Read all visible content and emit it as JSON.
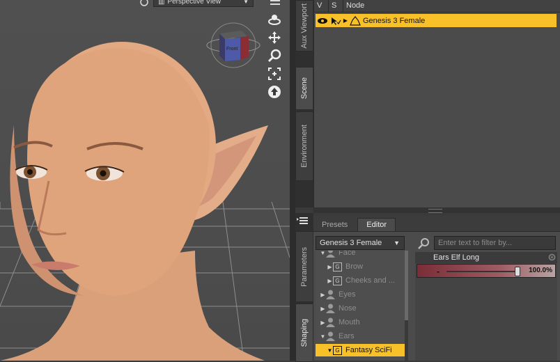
{
  "viewport": {
    "view_dropdown": "Perspective View"
  },
  "side_tabs_top": [
    {
      "label": "Aux Viewport"
    },
    {
      "label": "Scene"
    },
    {
      "label": "Environment"
    }
  ],
  "side_tabs_bottom": [
    {
      "label": "Parameters"
    },
    {
      "label": "Shaping"
    }
  ],
  "scene": {
    "columns": {
      "visible": "V",
      "select": "S",
      "node": "Node"
    },
    "nodes": [
      {
        "label": "Genesis 3 Female",
        "selected": true
      }
    ]
  },
  "params": {
    "tabs": [
      {
        "label": "Presets",
        "active": false
      },
      {
        "label": "Editor",
        "active": true
      }
    ],
    "node_select": "Genesis 3 Female",
    "filter_placeholder": "Enter text to filter by...",
    "tree": [
      {
        "label": "Face",
        "kind": "person",
        "expanded": true,
        "indent": 0
      },
      {
        "label": "Brow",
        "kind": "group",
        "expanded": false,
        "indent": 1
      },
      {
        "label": "Cheeks and ...",
        "kind": "group",
        "expanded": false,
        "indent": 1
      },
      {
        "label": "Eyes",
        "kind": "person",
        "expanded": false,
        "indent": 0
      },
      {
        "label": "Nose",
        "kind": "person",
        "expanded": false,
        "indent": 0
      },
      {
        "label": "Mouth",
        "kind": "person",
        "expanded": false,
        "indent": 0
      },
      {
        "label": "Ears",
        "kind": "person",
        "expanded": true,
        "indent": 0
      },
      {
        "label": "Fantasy SciFi",
        "kind": "group",
        "expanded": true,
        "indent": 1,
        "selected": true
      }
    ],
    "property": {
      "label": "Ears Elf Long",
      "value_text": "100.0%",
      "value": 1.0
    }
  },
  "colors": {
    "selection": "#f8c12a",
    "slider": "#7a2d37"
  }
}
